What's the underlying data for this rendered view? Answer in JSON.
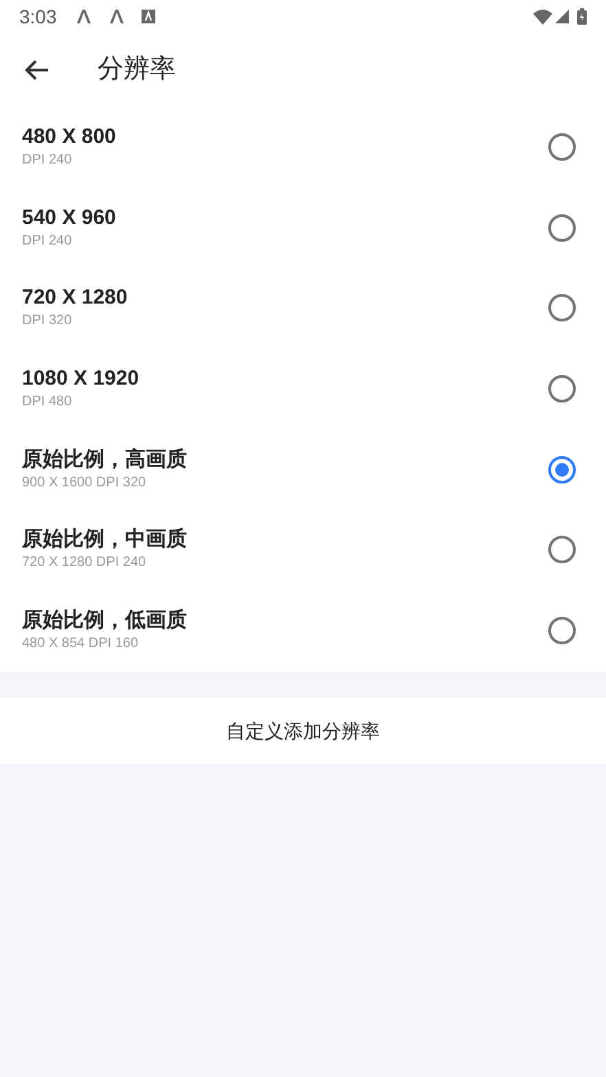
{
  "status_bar": {
    "time": "3:03"
  },
  "toolbar": {
    "title": "分辨率"
  },
  "options": [
    {
      "title": "480 X 800",
      "subtitle": "DPI 240",
      "selected": false
    },
    {
      "title": "540 X 960",
      "subtitle": "DPI 240",
      "selected": false
    },
    {
      "title": "720 X 1280",
      "subtitle": "DPI 320",
      "selected": false
    },
    {
      "title": "1080 X 1920",
      "subtitle": "DPI 480",
      "selected": false
    },
    {
      "title": "原始比例，高画质",
      "subtitle": "900 X 1600 DPI 320",
      "selected": true
    },
    {
      "title": "原始比例，中画质",
      "subtitle": "720 X 1280 DPI 240",
      "selected": false
    },
    {
      "title": "原始比例，低画质",
      "subtitle": "480 X 854 DPI 160",
      "selected": false
    }
  ],
  "custom_button": {
    "label": "自定义添加分辨率"
  }
}
